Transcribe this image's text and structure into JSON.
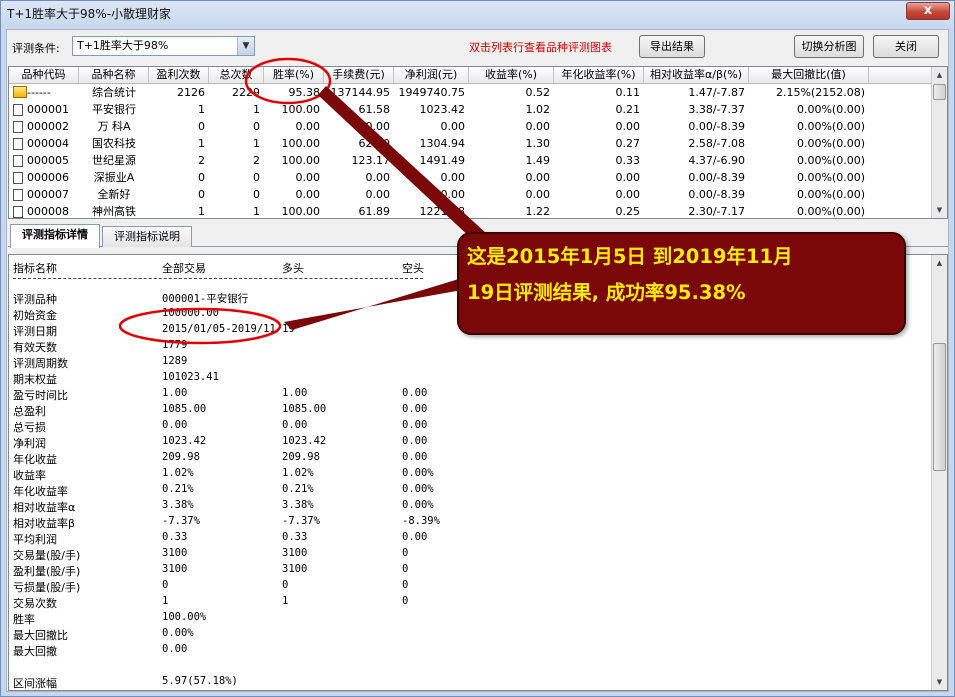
{
  "window": {
    "title": "T+1胜率大于98%-小散理财家",
    "close_glyph": "x"
  },
  "toolbar": {
    "condition_label": "评测条件:",
    "condition_value": "T+1胜率大于98%",
    "hint": "双击列表行查看品种评测图表",
    "export_label": "导出结果",
    "switch_label": "切换分析图",
    "close_label": "关闭"
  },
  "grid": {
    "columns": [
      "品种代码",
      "品种名称",
      "盈利次数",
      "总次数",
      "胜率(%)",
      "手续费(元)",
      "净利润(元)",
      "收益率(%)",
      "年化收益率(%)",
      "相对收益率α/β(%)",
      "最大回撤比(值)"
    ],
    "rows": [
      {
        "code": "------",
        "name": "综合统计",
        "wins": "2126",
        "total": "2229",
        "rate": "95.38",
        "fee": "137144.95",
        "profit": "1949740.75",
        "ret": "0.52",
        "annual": "0.11",
        "rel": "1.47/-7.87",
        "dd": "2.15%(2152.08)"
      },
      {
        "code": "000001",
        "name": "平安银行",
        "wins": "1",
        "total": "1",
        "rate": "100.00",
        "fee": "61.58",
        "profit": "1023.42",
        "ret": "1.02",
        "annual": "0.21",
        "rel": "3.38/-7.37",
        "dd": "0.00%(0.00)"
      },
      {
        "code": "000002",
        "name": "万 科A",
        "wins": "0",
        "total": "0",
        "rate": "0.00",
        "fee": "0.00",
        "profit": "0.00",
        "ret": "0.00",
        "annual": "0.00",
        "rel": "0.00/-8.39",
        "dd": "0.00%(0.00)"
      },
      {
        "code": "000004",
        "name": "国农科技",
        "wins": "1",
        "total": "1",
        "rate": "100.00",
        "fee": "62.00",
        "profit": "1304.94",
        "ret": "1.30",
        "annual": "0.27",
        "rel": "2.58/-7.08",
        "dd": "0.00%(0.00)"
      },
      {
        "code": "000005",
        "name": "世纪星源",
        "wins": "2",
        "total": "2",
        "rate": "100.00",
        "fee": "123.17",
        "profit": "1491.49",
        "ret": "1.49",
        "annual": "0.33",
        "rel": "4.37/-6.90",
        "dd": "0.00%(0.00)"
      },
      {
        "code": "000006",
        "name": "深振业A",
        "wins": "0",
        "total": "0",
        "rate": "0.00",
        "fee": "0.00",
        "profit": "0.00",
        "ret": "0.00",
        "annual": "0.00",
        "rel": "0.00/-8.39",
        "dd": "0.00%(0.00)"
      },
      {
        "code": "000007",
        "name": "全新好",
        "wins": "0",
        "total": "0",
        "rate": "0.00",
        "fee": "0.00",
        "profit": "0.00",
        "ret": "0.00",
        "annual": "0.00",
        "rel": "0.00/-8.39",
        "dd": "0.00%(0.00)"
      },
      {
        "code": "000008",
        "name": "神州高铁",
        "wins": "1",
        "total": "1",
        "rate": "100.00",
        "fee": "61.89",
        "profit": "1221.18",
        "ret": "1.22",
        "annual": "0.25",
        "rel": "2.30/-7.17",
        "dd": "0.00%(0.00)"
      }
    ]
  },
  "tabs": [
    {
      "label": "评测指标详情",
      "active": true
    },
    {
      "label": "评测指标说明",
      "active": false
    }
  ],
  "detail": {
    "headers": [
      "指标名称",
      "全部交易",
      "多头",
      "空头"
    ],
    "rows": [
      {
        "label": "评测品种",
        "all": "000001-平安银行",
        "long": "",
        "short": ""
      },
      {
        "label": "初始资金",
        "all": "100000.00",
        "long": "",
        "short": ""
      },
      {
        "label": "评测日期",
        "all": "2015/01/05-2019/11/19",
        "long": "",
        "short": ""
      },
      {
        "label": "有效天数",
        "all": "1779",
        "long": "",
        "short": ""
      },
      {
        "label": "评测周期数",
        "all": "1289",
        "long": "",
        "short": ""
      },
      {
        "label": "期末权益",
        "all": "101023.41",
        "long": "",
        "short": ""
      },
      {
        "label": "盈亏时间比",
        "all": "1.00",
        "long": "1.00",
        "short": "0.00"
      },
      {
        "label": "总盈利",
        "all": "1085.00",
        "long": "1085.00",
        "short": "0.00"
      },
      {
        "label": "总亏损",
        "all": "0.00",
        "long": "0.00",
        "short": "0.00"
      },
      {
        "label": "净利润",
        "all": "1023.42",
        "long": "1023.42",
        "short": "0.00"
      },
      {
        "label": "年化收益",
        "all": "209.98",
        "long": "209.98",
        "short": "0.00"
      },
      {
        "label": "收益率",
        "all": "1.02%",
        "long": "1.02%",
        "short": "0.00%"
      },
      {
        "label": "年化收益率",
        "all": "0.21%",
        "long": "0.21%",
        "short": "0.00%"
      },
      {
        "label": "相对收益率α",
        "all": "3.38%",
        "long": "3.38%",
        "short": "0.00%"
      },
      {
        "label": "相对收益率β",
        "all": "-7.37%",
        "long": "-7.37%",
        "short": "-8.39%"
      },
      {
        "label": "平均利润",
        "all": "0.33",
        "long": "0.33",
        "short": "0.00"
      },
      {
        "label": "交易量(股/手)",
        "all": "3100",
        "long": "3100",
        "short": "0"
      },
      {
        "label": "盈利量(股/手)",
        "all": "3100",
        "long": "3100",
        "short": "0"
      },
      {
        "label": "亏损量(股/手)",
        "all": "0",
        "long": "0",
        "short": "0"
      },
      {
        "label": "交易次数",
        "all": "1",
        "long": "1",
        "short": "0"
      },
      {
        "label": "胜率",
        "all": "100.00%",
        "long": "",
        "short": ""
      },
      {
        "label": "最大回撤比",
        "all": "0.00%",
        "long": "",
        "short": ""
      },
      {
        "label": "最大回撤",
        "all": "0.00",
        "long": "",
        "short": ""
      },
      {
        "label": "",
        "all": "",
        "long": "",
        "short": ""
      },
      {
        "label": "区间涨幅",
        "all": "5.97(57.18%)",
        "long": "",
        "short": ""
      }
    ]
  },
  "callout": {
    "line1": "这是2015年1月5日 到2019年11月",
    "line2": "19日评测结果, 成功率95.38%"
  },
  "colors": {
    "hint_red": "#d00000",
    "callout_bg": "#7a0808",
    "callout_text": "#ffeb00",
    "annotation_red": "#e00000"
  }
}
